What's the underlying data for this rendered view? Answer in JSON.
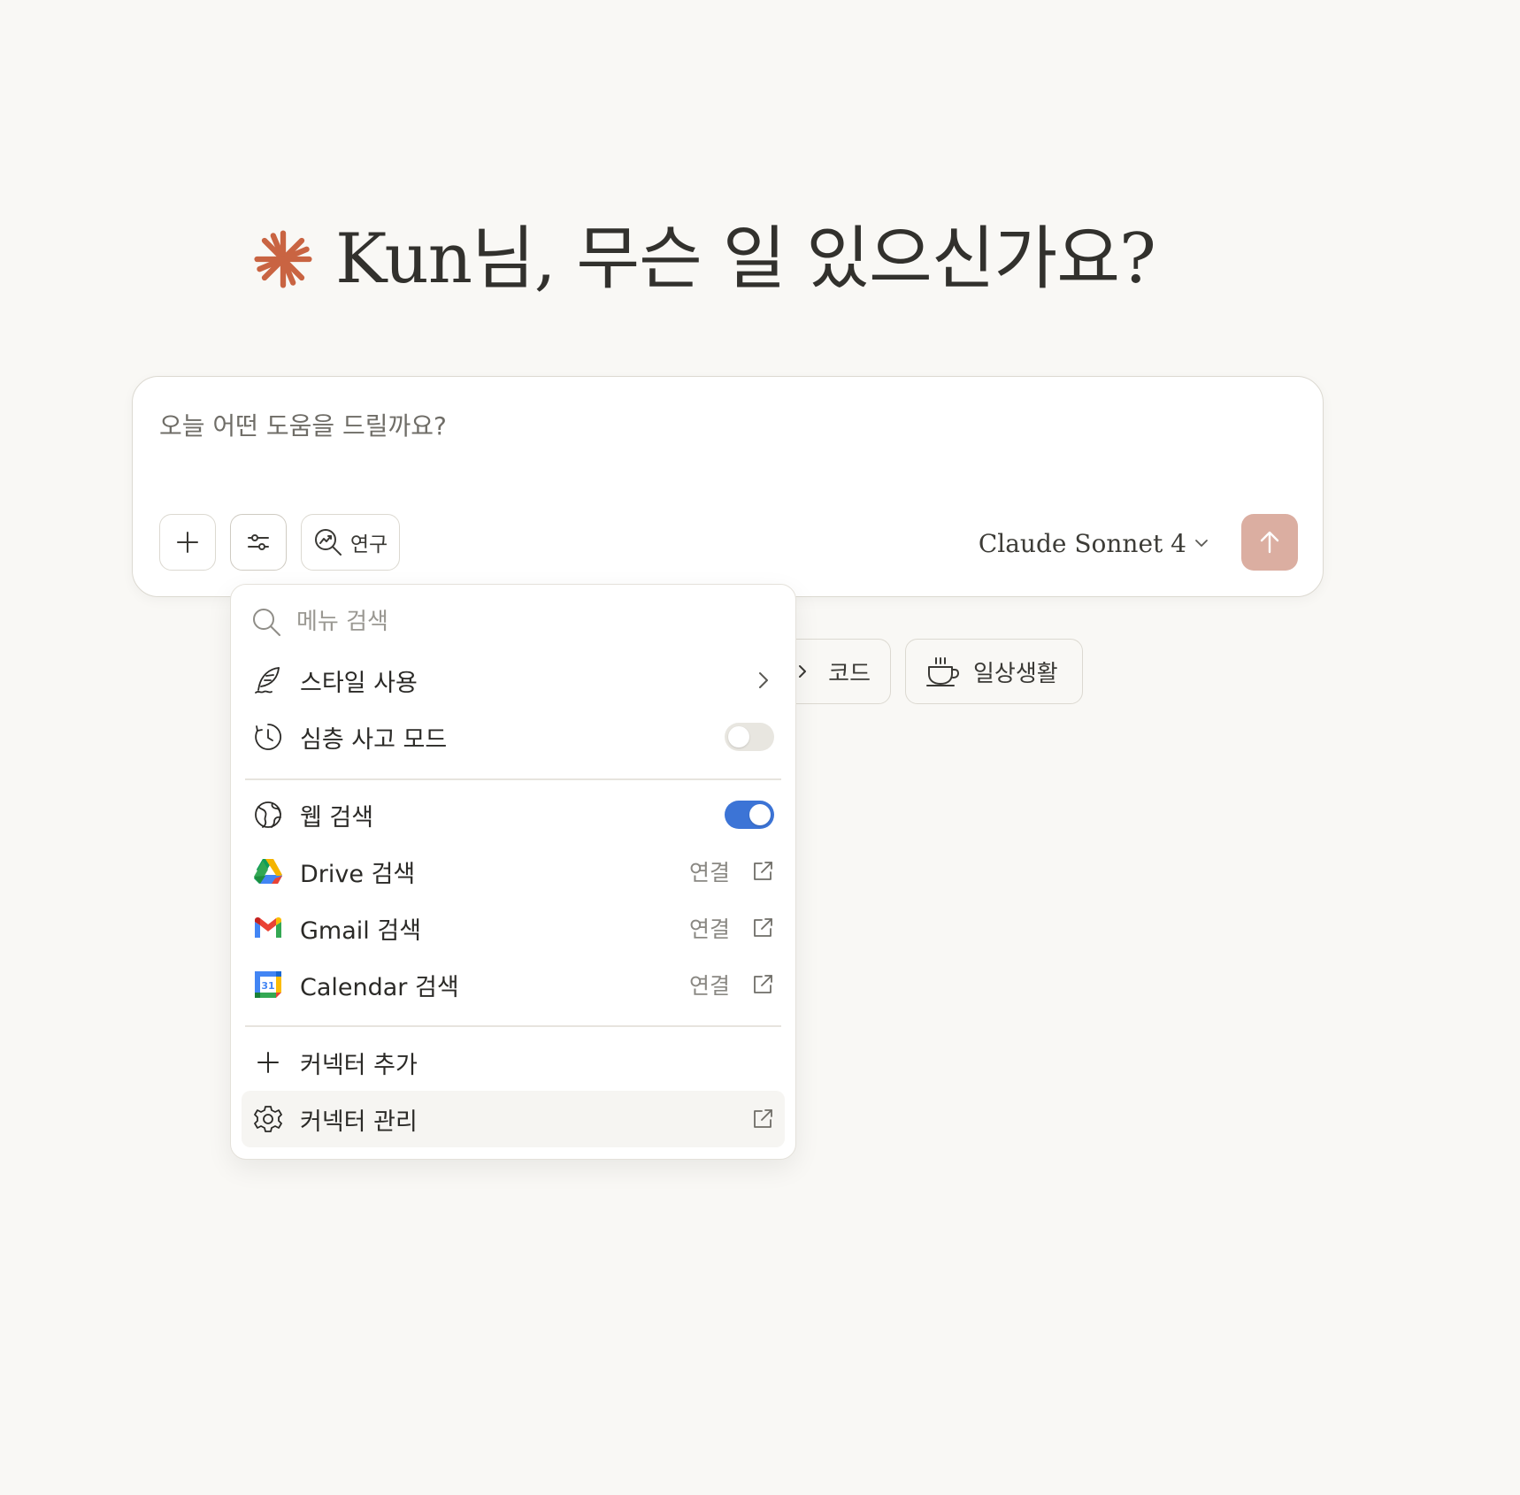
{
  "greeting": {
    "text": "Kun님, 무슨 일 있으신가요?"
  },
  "composer": {
    "placeholder": "오늘 어떤 도움을 드릴까요?",
    "research_label": "연구",
    "model_name": "Claude Sonnet 4"
  },
  "chips": [
    {
      "label": "코드",
      "icon": "code-icon"
    },
    {
      "label": "일상생활",
      "icon": "coffee-cup-icon"
    }
  ],
  "menu": {
    "search_placeholder": "메뉴 검색",
    "items": [
      {
        "label": "스타일 사용",
        "icon": "feather-pen-icon",
        "right": "chevron-right-icon"
      },
      {
        "label": "심층 사고 모드",
        "icon": "clock-icon",
        "toggle": false
      },
      {
        "label": "웹 검색",
        "icon": "globe-icon",
        "toggle": true
      },
      {
        "label": "Drive 검색",
        "icon": "google-drive-icon",
        "action": "연결"
      },
      {
        "label": "Gmail 검색",
        "icon": "gmail-icon",
        "action": "연결"
      },
      {
        "label": "Calendar 검색",
        "icon": "google-calendar-icon",
        "action": "연결",
        "calendar_day": "31"
      },
      {
        "label": "커넥터 추가",
        "icon": "plus-icon"
      },
      {
        "label": "커넥터 관리",
        "icon": "gear-icon",
        "right": "external-link-icon"
      }
    ]
  },
  "colors": {
    "background": "#f9f8f5",
    "accent_spark": "#c96442",
    "send_button": "#dbaea1",
    "toggle_on": "#3c74d6",
    "toggle_off": "#e8e6e0"
  }
}
